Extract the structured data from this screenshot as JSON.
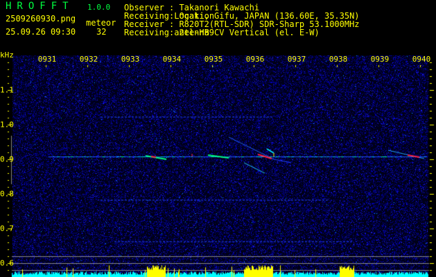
{
  "header": {
    "app_title": "HROFFT",
    "version": "1.0.0",
    "filename": "2509260930.png",
    "datetime": "25.09.26 09:30",
    "meteor_label": "meteor",
    "meteor_count": "32",
    "info": [
      {
        "label": "Observer",
        "value": ": Takanori Kawachi"
      },
      {
        "label": "Receiving Location",
        "value": ": Ogaki, Gifu, JAPAN (136.60E, 35.35N)"
      },
      {
        "label": "Receiver",
        "value": ": R820T2(RTL-SDR) SDR-Sharp 53.1000MHz"
      },
      {
        "label": "Receiving antenna",
        "value": ": 2el-HB9CV Vertical (el. E-W)"
      }
    ]
  },
  "colors": {
    "text": "#ffff00",
    "title": "#00ff40",
    "noise": "#0000a0",
    "histogram": "#00ffff",
    "histogram_peak": "#ffff00"
  },
  "chart_data": {
    "type": "heatmap",
    "ylabel": "kHz",
    "x_ticks": [
      "0931",
      "0932",
      "0933",
      "0934",
      "0935",
      "0936",
      "0937",
      "0938",
      "0939",
      "0940"
    ],
    "y_ticks": [
      "1.1",
      "1.0",
      "0.9",
      "0.8",
      "0.7",
      "0.6"
    ],
    "ylim": [
      0.56,
      1.2
    ],
    "xlim_minutes": [
      930.2,
      940.1
    ],
    "carrier_khz": 0.905,
    "meteor_echo_minutes": [
      934.3,
      936.9,
      937.7,
      939.7
    ]
  }
}
